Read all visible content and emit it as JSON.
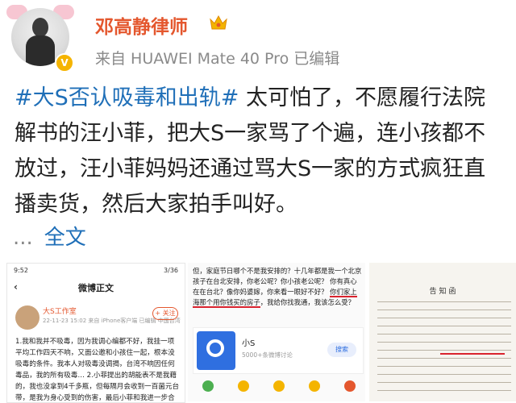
{
  "header": {
    "username": "邓高静律师",
    "source": "来自 HUAWEI Mate 40 Pro  已编辑",
    "verified_badge": "V"
  },
  "post": {
    "line1_hashtag": "#大S否认吸毒和出轨#",
    "line1_rest": " 太可怕了，不愿履行法院",
    "line2": "解书的汪小菲，把大S一家骂了个遍，连小孩都不",
    "line3": "放过，汪小菲妈妈还通过骂大S一家的方式疯狂直",
    "line4": "播卖货，然后大家拍手叫好。",
    "more_dots": "...",
    "more_label": "全文"
  },
  "images": {
    "img1": {
      "status_time": "9:52",
      "status_right": "3/36",
      "back": "‹",
      "nav_title": "微博正文",
      "account_name": "大S工作室",
      "account_meta": "22-11-23 15:02  来自 iPhone客户端  已编辑  中国台湾",
      "follow_label": "+ 关注",
      "body": "1.我和我并不吸毒，因为我调心编都不好，我挂一项平均工作四天不响，又面公邀和小孩住一起，根本没吸毒的条件。我本人对吸毒没调揭，台湾不响因任何毒品，我的所有吸毒… 2.小菲提出的胡能表不是我藉的，我也没拿到4千多瓶，但每隔月会收到一百菌元台带，是我为身心受到的伤害，最后小菲和我进一步合意的实调，…"
    },
    "img2": {
      "text1": "但，家庭节日哪个不是我安排的？十几年都是我一个北京孩子在台北安排，你老公呢？你小孩老公呢？",
      "text2": "你有真心在在台北？像你妈婆嫁，你来看一眼好不好？",
      "underline_text": "你们家上海那个用你钱买的房子",
      "text3": "，我给你找我通，我该怎么受？",
      "card_title": "小S",
      "card_sub": "5000+条微博讨论",
      "join_label": "搜索"
    },
    "img3": {
      "doc_title": "告 知 函"
    }
  },
  "colors": {
    "accent_orange": "#e4572e",
    "link_blue": "#1f6fb8",
    "text": "#222222",
    "muted": "#8a8a8a"
  }
}
